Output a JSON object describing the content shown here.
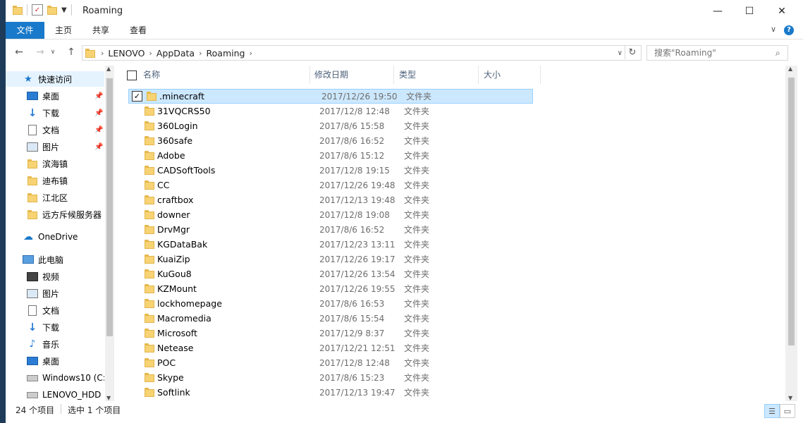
{
  "window": {
    "title": "Roaming",
    "controls": {
      "minimize": "—",
      "maximize": "☐",
      "close": "✕"
    }
  },
  "ribbon": {
    "tabs": [
      "文件",
      "主页",
      "共享",
      "查看"
    ],
    "expand_icon": "chevron-down-icon",
    "help_icon": "help-icon"
  },
  "address": {
    "breadcrumbs": [
      "LENOVO",
      "AppData",
      "Roaming"
    ],
    "search_placeholder": "搜索\"Roaming\""
  },
  "nav": {
    "items": [
      {
        "label": "快速访问",
        "icon": "star-icon",
        "selected": true
      },
      {
        "label": "桌面",
        "icon": "desktop-icon",
        "pinned": true
      },
      {
        "label": "下载",
        "icon": "download-icon",
        "pinned": true
      },
      {
        "label": "文档",
        "icon": "document-icon",
        "pinned": true
      },
      {
        "label": "图片",
        "icon": "picture-icon",
        "pinned": true
      },
      {
        "label": "滨海镇",
        "icon": "folder-icon"
      },
      {
        "label": "迪布镇",
        "icon": "folder-icon"
      },
      {
        "label": "江北区",
        "icon": "folder-icon"
      },
      {
        "label": "远方斥候服务器",
        "icon": "folder-icon"
      },
      {
        "label": "OneDrive",
        "icon": "cloud-icon"
      },
      {
        "label": "此电脑",
        "icon": "computer-icon"
      },
      {
        "label": "视频",
        "icon": "video-icon"
      },
      {
        "label": "图片",
        "icon": "picture-icon"
      },
      {
        "label": "文档",
        "icon": "document-icon"
      },
      {
        "label": "下载",
        "icon": "download-icon"
      },
      {
        "label": "音乐",
        "icon": "music-icon"
      },
      {
        "label": "桌面",
        "icon": "desktop-icon"
      },
      {
        "label": "Windows10 (C:",
        "icon": "drive-icon"
      },
      {
        "label": "LENOVO_HDD",
        "icon": "drive-icon"
      }
    ]
  },
  "columns": [
    "名称",
    "修改日期",
    "类型",
    "大小"
  ],
  "files": [
    {
      "name": ".minecraft",
      "date": "2017/12/26 19:50",
      "type": "文件夹",
      "selected": true
    },
    {
      "name": "31VQCRS50",
      "date": "2017/12/8 12:48",
      "type": "文件夹"
    },
    {
      "name": "360Login",
      "date": "2017/8/6 15:58",
      "type": "文件夹"
    },
    {
      "name": "360safe",
      "date": "2017/8/6 16:52",
      "type": "文件夹"
    },
    {
      "name": "Adobe",
      "date": "2017/8/6 15:12",
      "type": "文件夹"
    },
    {
      "name": "CADSoftTools",
      "date": "2017/12/8 19:15",
      "type": "文件夹"
    },
    {
      "name": "CC",
      "date": "2017/12/26 19:48",
      "type": "文件夹"
    },
    {
      "name": "craftbox",
      "date": "2017/12/13 19:48",
      "type": "文件夹"
    },
    {
      "name": "downer",
      "date": "2017/12/8 19:08",
      "type": "文件夹"
    },
    {
      "name": "DrvMgr",
      "date": "2017/8/6 16:52",
      "type": "文件夹"
    },
    {
      "name": "KGDataBak",
      "date": "2017/12/23 13:11",
      "type": "文件夹"
    },
    {
      "name": "KuaiZip",
      "date": "2017/12/26 19:17",
      "type": "文件夹"
    },
    {
      "name": "KuGou8",
      "date": "2017/12/26 13:54",
      "type": "文件夹"
    },
    {
      "name": "KZMount",
      "date": "2017/12/26 19:55",
      "type": "文件夹"
    },
    {
      "name": "lockhomepage",
      "date": "2017/8/6 16:53",
      "type": "文件夹"
    },
    {
      "name": "Macromedia",
      "date": "2017/8/6 15:54",
      "type": "文件夹"
    },
    {
      "name": "Microsoft",
      "date": "2017/12/9 8:37",
      "type": "文件夹"
    },
    {
      "name": "Netease",
      "date": "2017/12/21 12:51",
      "type": "文件夹"
    },
    {
      "name": "POC",
      "date": "2017/12/8 12:48",
      "type": "文件夹"
    },
    {
      "name": "Skype",
      "date": "2017/8/6 15:23",
      "type": "文件夹"
    },
    {
      "name": "Softlink",
      "date": "2017/12/13 19:47",
      "type": "文件夹"
    }
  ],
  "status": {
    "item_count": "24 个项目",
    "selected_count": "选中 1 个项目"
  },
  "colors": {
    "accent": "#1979ca",
    "selection": "#cce8ff",
    "folder": "#f7d374"
  }
}
